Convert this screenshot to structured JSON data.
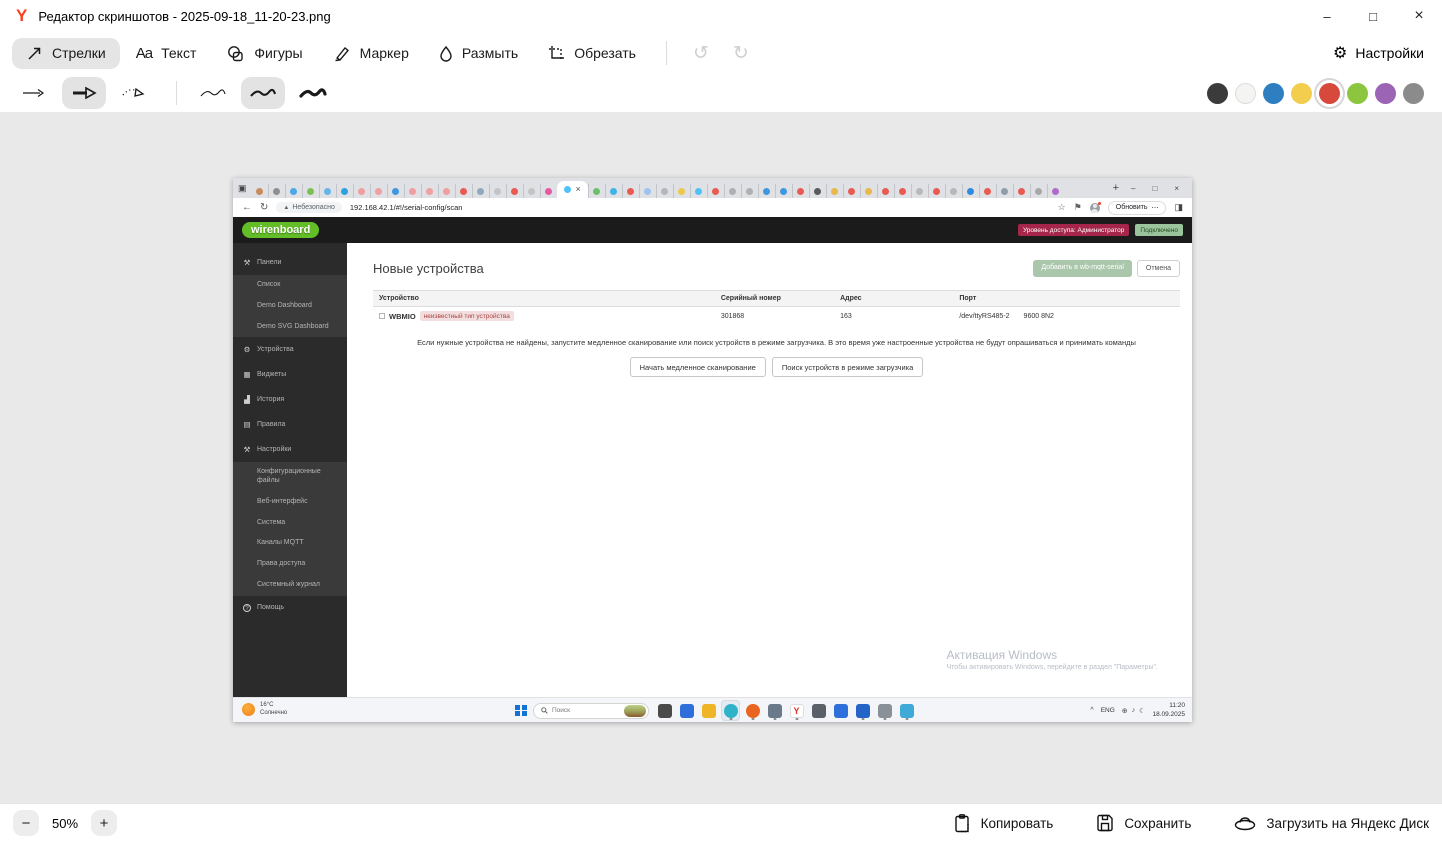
{
  "editor": {
    "window_title": "Редактор скриншотов - 2025-09-18_11-20-23.png",
    "window_controls": {
      "minimize": "–",
      "maximize": "□",
      "close": "×"
    },
    "tools": [
      {
        "label": "Стрелки",
        "selected": true
      },
      {
        "label": "Текст"
      },
      {
        "label": "Фигуры"
      },
      {
        "label": "Маркер"
      },
      {
        "label": "Размыть"
      },
      {
        "label": "Обрезать"
      }
    ],
    "history": {
      "undo": "↺",
      "redo": "↻"
    },
    "settings_label": "Настройки",
    "stroke_options": [
      "arrow-thin",
      "arrow-bold",
      "arrow-dotted",
      "scribble-thin",
      "scribble-medium",
      "scribble-bold"
    ],
    "selected_arrow_index": 1,
    "selected_scribble_index": 1,
    "colors": [
      "#3b3b3b",
      "#f4f4f2",
      "#2e7fc2",
      "#f3cd4e",
      "#d8493d",
      "#8cc63e",
      "#9b64b5",
      "#8b8b8b"
    ],
    "selected_color_index": 4,
    "zoom": {
      "minus": "−",
      "value": "50%",
      "plus": "+"
    },
    "actions": {
      "copy": "Копировать",
      "save": "Сохранить",
      "upload": "Загрузить на Яндекс Диск"
    }
  },
  "browser": {
    "tab_search_icon": "▣",
    "active_tab_index": 18,
    "tab_favicons": [
      "#c98a5c",
      "#8f8f8f",
      "#4aa8e8",
      "#7cc054",
      "#66b5e8",
      "#2aa3e0",
      "#ef9f9f",
      "#ef9f9f",
      "#3f97e0",
      "#ef9f9f",
      "#ef9f9f",
      "#ef9f9f",
      "#e85a52",
      "#8fa8bc",
      "#c4c4c4",
      "#e85a52",
      "#c4c4c4",
      "#e55aa0",
      "#4fc3f7",
      "#6cc06c",
      "#3fb3e8",
      "#e85a52",
      "#9fc3ef",
      "#b5b5bd",
      "#ecc84f",
      "#4fc3f7",
      "#e85a52",
      "#b0b0b0",
      "#b0b0b0",
      "#3f97e0",
      "#3f97e0",
      "#e85a52",
      "#5a5a5a",
      "#e8b84a",
      "#e85a52",
      "#e8b84a",
      "#e85a52",
      "#e85a52",
      "#b8b8b8",
      "#e85a52",
      "#b8b8b8",
      "#2f8ae0",
      "#e85a52",
      "#8f9cac",
      "#e85a52",
      "#a8a8a8",
      "#b06ac8"
    ],
    "new_tab_button": "+",
    "window_controls": {
      "minimize": "–",
      "restore": "□",
      "close": "×"
    },
    "back_icon": "←",
    "reload_icon": "↻",
    "security_warning_icon": "▲",
    "security_label": "Небезопасно",
    "url": "192.168.42.1/#!/serial-config/scan",
    "bookmark_icon": "☆",
    "collections_icon": "⚑",
    "update_button": "Обновить",
    "more_dots": "⋯",
    "sidepanel_icon": "◨"
  },
  "wirenboard": {
    "logo": "wirenboard",
    "access_badge": "Уровень доступа: Администратор",
    "connection_badge": "Подключено",
    "sidebar": [
      {
        "label": "Панели",
        "type": "section",
        "icon": "⚒"
      },
      {
        "label": "Список",
        "type": "sub"
      },
      {
        "label": "Demo Dashboard",
        "type": "sub"
      },
      {
        "label": "Demo SVG Dashboard",
        "type": "sub"
      },
      {
        "label": "Устройства",
        "type": "section",
        "icon": "⚙"
      },
      {
        "label": "Виджеты",
        "type": "section",
        "icon": "▦"
      },
      {
        "label": "История",
        "type": "section",
        "icon": "▟"
      },
      {
        "label": "Правила",
        "type": "section",
        "icon": "▤"
      },
      {
        "label": "Настройки",
        "type": "section",
        "icon": "⚒"
      },
      {
        "label": "Конфигурационные файлы",
        "type": "sub"
      },
      {
        "label": "Веб-интерфейс",
        "type": "sub"
      },
      {
        "label": "Система",
        "type": "sub"
      },
      {
        "label": "Каналы MQTT",
        "type": "sub"
      },
      {
        "label": "Права доступа",
        "type": "sub"
      },
      {
        "label": "Системный журнал",
        "type": "sub"
      },
      {
        "label": "Помощь",
        "type": "section",
        "icon": "?"
      }
    ],
    "page": {
      "title": "Новые устройства",
      "add_button": "Добавить в wb-mqtt-serial",
      "cancel_button": "Отмена",
      "table_headers": [
        "Устройство",
        "Серийный номер",
        "Адрес",
        "Порт"
      ],
      "device": {
        "name": "WBMIO",
        "type_badge": "неизвестный тип устройства",
        "serial": "301868",
        "address": "163",
        "port": "/dev/ttyRS485-2",
        "mode": "9600 8N2"
      },
      "hint": "Если нужные устройства не найдены, запустите медленное сканирование или поиск устройств в режиме загрузчика. В это время уже настроенные устройства не будут опрашиваться и принимать команды",
      "slow_scan_button": "Начать медленное сканирование",
      "bootloader_button": "Поиск устройств в режиме загрузчика"
    },
    "watermark": {
      "line1": "Активация Windows",
      "line2": "Чтобы активировать Windows, перейдите в раздел \"Параметры\"."
    }
  },
  "taskbar": {
    "weather": {
      "temp": "16°C",
      "condition": "Солнечно"
    },
    "search_placeholder": "Поиск",
    "icons": [
      {
        "name": "task-view",
        "color": "#4a4a4a",
        "running": false
      },
      {
        "name": "microsoft-store",
        "color": "#2f6fdb",
        "running": false
      },
      {
        "name": "file-explorer",
        "color": "#f0b429",
        "running": false
      },
      {
        "name": "edge-browser",
        "color": "#2fb3c8",
        "active": true,
        "running": true
      },
      {
        "name": "firefox-browser",
        "color": "#e8641f",
        "running": true
      },
      {
        "name": "calculator",
        "color": "#6a7a8a",
        "running": true
      },
      {
        "name": "yandex-browser",
        "color": "#ffffff",
        "letter": "Y",
        "letter_color": "#e03226",
        "running": true
      },
      {
        "name": "usb-tool",
        "color": "#5a6068",
        "running": false
      },
      {
        "name": "remote-window",
        "color": "#2f6fdb",
        "running": false
      },
      {
        "name": "wireshark",
        "color": "#2464c8",
        "running": true
      },
      {
        "name": "printer-tool",
        "color": "#8a9098",
        "running": true
      },
      {
        "name": "photos-app",
        "color": "#3fa9d8",
        "running": true
      }
    ],
    "tray": {
      "chevron": "^",
      "lang": "ENG",
      "glyphs": [
        {
          "name": "network-icon",
          "glyph": "⊕"
        },
        {
          "name": "volume-icon",
          "glyph": "♪"
        },
        {
          "name": "battery-icon",
          "glyph": "☾"
        }
      ],
      "time": "11:20",
      "date": "18.09.2025"
    }
  }
}
